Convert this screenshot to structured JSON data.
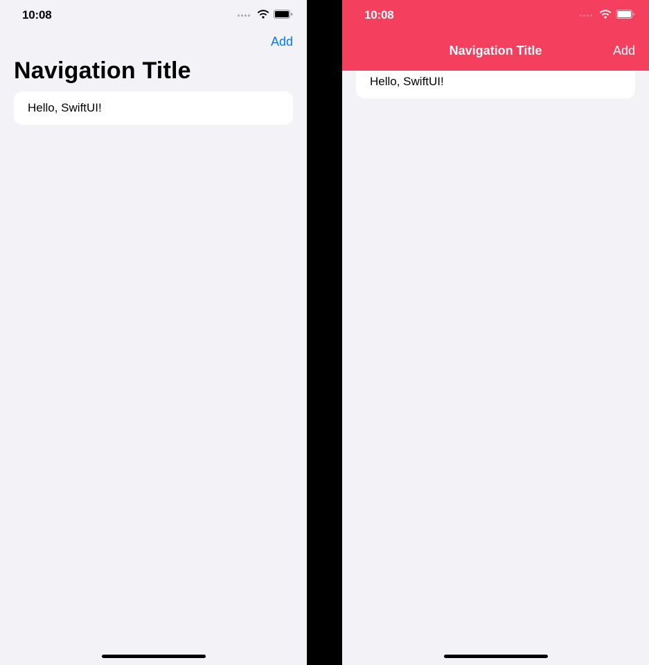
{
  "status": {
    "time": "10:08"
  },
  "left": {
    "nav_title": "Navigation Title",
    "add_label": "Add",
    "cell_text": "Hello, SwiftUI!"
  },
  "right": {
    "nav_title": "Navigation Title",
    "add_label": "Add",
    "cell_text": "Hello, SwiftUI!"
  },
  "colors": {
    "accent_blue": "#007aff",
    "accent_pink": "#f43f5e",
    "background": "#f2f2f7"
  }
}
